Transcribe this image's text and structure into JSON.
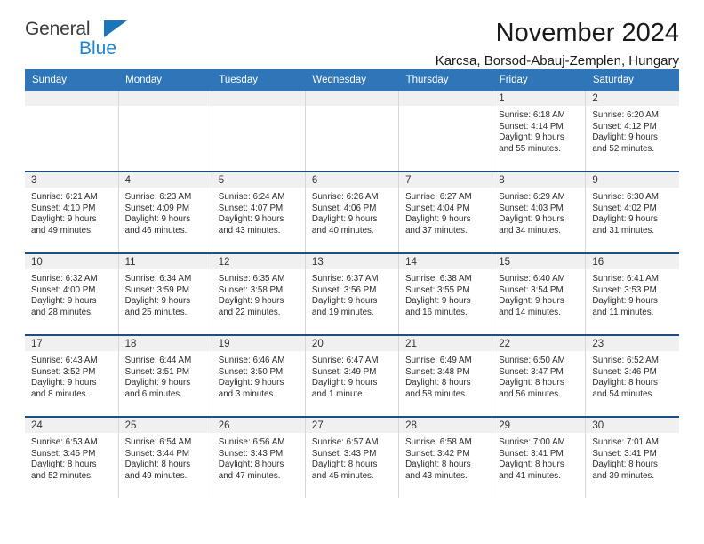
{
  "brand": {
    "name_top": "General",
    "name_bottom": "Blue",
    "triangle_color": "#1b75bb"
  },
  "header": {
    "title": "November 2024",
    "subtitle": "Karcsa, Borsod-Abauj-Zemplen, Hungary"
  },
  "theme": {
    "header_blue": "#2e76b8",
    "row_rule": "#1c4e80",
    "daynum_band": "#f0f0f0"
  },
  "weekday_headers": [
    "Sunday",
    "Monday",
    "Tuesday",
    "Wednesday",
    "Thursday",
    "Friday",
    "Saturday"
  ],
  "weeks": [
    [
      {
        "day": "",
        "empty": true,
        "sunrise": "",
        "sunset": "",
        "daylight_line1": "",
        "daylight_line2": ""
      },
      {
        "day": "",
        "empty": true,
        "sunrise": "",
        "sunset": "",
        "daylight_line1": "",
        "daylight_line2": ""
      },
      {
        "day": "",
        "empty": true,
        "sunrise": "",
        "sunset": "",
        "daylight_line1": "",
        "daylight_line2": ""
      },
      {
        "day": "",
        "empty": true,
        "sunrise": "",
        "sunset": "",
        "daylight_line1": "",
        "daylight_line2": ""
      },
      {
        "day": "",
        "empty": true,
        "sunrise": "",
        "sunset": "",
        "daylight_line1": "",
        "daylight_line2": ""
      },
      {
        "day": "1",
        "empty": false,
        "sunrise": "Sunrise: 6:18 AM",
        "sunset": "Sunset: 4:14 PM",
        "daylight_line1": "Daylight: 9 hours",
        "daylight_line2": "and 55 minutes."
      },
      {
        "day": "2",
        "empty": false,
        "sunrise": "Sunrise: 6:20 AM",
        "sunset": "Sunset: 4:12 PM",
        "daylight_line1": "Daylight: 9 hours",
        "daylight_line2": "and 52 minutes."
      }
    ],
    [
      {
        "day": "3",
        "empty": false,
        "sunrise": "Sunrise: 6:21 AM",
        "sunset": "Sunset: 4:10 PM",
        "daylight_line1": "Daylight: 9 hours",
        "daylight_line2": "and 49 minutes."
      },
      {
        "day": "4",
        "empty": false,
        "sunrise": "Sunrise: 6:23 AM",
        "sunset": "Sunset: 4:09 PM",
        "daylight_line1": "Daylight: 9 hours",
        "daylight_line2": "and 46 minutes."
      },
      {
        "day": "5",
        "empty": false,
        "sunrise": "Sunrise: 6:24 AM",
        "sunset": "Sunset: 4:07 PM",
        "daylight_line1": "Daylight: 9 hours",
        "daylight_line2": "and 43 minutes."
      },
      {
        "day": "6",
        "empty": false,
        "sunrise": "Sunrise: 6:26 AM",
        "sunset": "Sunset: 4:06 PM",
        "daylight_line1": "Daylight: 9 hours",
        "daylight_line2": "and 40 minutes."
      },
      {
        "day": "7",
        "empty": false,
        "sunrise": "Sunrise: 6:27 AM",
        "sunset": "Sunset: 4:04 PM",
        "daylight_line1": "Daylight: 9 hours",
        "daylight_line2": "and 37 minutes."
      },
      {
        "day": "8",
        "empty": false,
        "sunrise": "Sunrise: 6:29 AM",
        "sunset": "Sunset: 4:03 PM",
        "daylight_line1": "Daylight: 9 hours",
        "daylight_line2": "and 34 minutes."
      },
      {
        "day": "9",
        "empty": false,
        "sunrise": "Sunrise: 6:30 AM",
        "sunset": "Sunset: 4:02 PM",
        "daylight_line1": "Daylight: 9 hours",
        "daylight_line2": "and 31 minutes."
      }
    ],
    [
      {
        "day": "10",
        "empty": false,
        "sunrise": "Sunrise: 6:32 AM",
        "sunset": "Sunset: 4:00 PM",
        "daylight_line1": "Daylight: 9 hours",
        "daylight_line2": "and 28 minutes."
      },
      {
        "day": "11",
        "empty": false,
        "sunrise": "Sunrise: 6:34 AM",
        "sunset": "Sunset: 3:59 PM",
        "daylight_line1": "Daylight: 9 hours",
        "daylight_line2": "and 25 minutes."
      },
      {
        "day": "12",
        "empty": false,
        "sunrise": "Sunrise: 6:35 AM",
        "sunset": "Sunset: 3:58 PM",
        "daylight_line1": "Daylight: 9 hours",
        "daylight_line2": "and 22 minutes."
      },
      {
        "day": "13",
        "empty": false,
        "sunrise": "Sunrise: 6:37 AM",
        "sunset": "Sunset: 3:56 PM",
        "daylight_line1": "Daylight: 9 hours",
        "daylight_line2": "and 19 minutes."
      },
      {
        "day": "14",
        "empty": false,
        "sunrise": "Sunrise: 6:38 AM",
        "sunset": "Sunset: 3:55 PM",
        "daylight_line1": "Daylight: 9 hours",
        "daylight_line2": "and 16 minutes."
      },
      {
        "day": "15",
        "empty": false,
        "sunrise": "Sunrise: 6:40 AM",
        "sunset": "Sunset: 3:54 PM",
        "daylight_line1": "Daylight: 9 hours",
        "daylight_line2": "and 14 minutes."
      },
      {
        "day": "16",
        "empty": false,
        "sunrise": "Sunrise: 6:41 AM",
        "sunset": "Sunset: 3:53 PM",
        "daylight_line1": "Daylight: 9 hours",
        "daylight_line2": "and 11 minutes."
      }
    ],
    [
      {
        "day": "17",
        "empty": false,
        "sunrise": "Sunrise: 6:43 AM",
        "sunset": "Sunset: 3:52 PM",
        "daylight_line1": "Daylight: 9 hours",
        "daylight_line2": "and 8 minutes."
      },
      {
        "day": "18",
        "empty": false,
        "sunrise": "Sunrise: 6:44 AM",
        "sunset": "Sunset: 3:51 PM",
        "daylight_line1": "Daylight: 9 hours",
        "daylight_line2": "and 6 minutes."
      },
      {
        "day": "19",
        "empty": false,
        "sunrise": "Sunrise: 6:46 AM",
        "sunset": "Sunset: 3:50 PM",
        "daylight_line1": "Daylight: 9 hours",
        "daylight_line2": "and 3 minutes."
      },
      {
        "day": "20",
        "empty": false,
        "sunrise": "Sunrise: 6:47 AM",
        "sunset": "Sunset: 3:49 PM",
        "daylight_line1": "Daylight: 9 hours",
        "daylight_line2": "and 1 minute."
      },
      {
        "day": "21",
        "empty": false,
        "sunrise": "Sunrise: 6:49 AM",
        "sunset": "Sunset: 3:48 PM",
        "daylight_line1": "Daylight: 8 hours",
        "daylight_line2": "and 58 minutes."
      },
      {
        "day": "22",
        "empty": false,
        "sunrise": "Sunrise: 6:50 AM",
        "sunset": "Sunset: 3:47 PM",
        "daylight_line1": "Daylight: 8 hours",
        "daylight_line2": "and 56 minutes."
      },
      {
        "day": "23",
        "empty": false,
        "sunrise": "Sunrise: 6:52 AM",
        "sunset": "Sunset: 3:46 PM",
        "daylight_line1": "Daylight: 8 hours",
        "daylight_line2": "and 54 minutes."
      }
    ],
    [
      {
        "day": "24",
        "empty": false,
        "sunrise": "Sunrise: 6:53 AM",
        "sunset": "Sunset: 3:45 PM",
        "daylight_line1": "Daylight: 8 hours",
        "daylight_line2": "and 52 minutes."
      },
      {
        "day": "25",
        "empty": false,
        "sunrise": "Sunrise: 6:54 AM",
        "sunset": "Sunset: 3:44 PM",
        "daylight_line1": "Daylight: 8 hours",
        "daylight_line2": "and 49 minutes."
      },
      {
        "day": "26",
        "empty": false,
        "sunrise": "Sunrise: 6:56 AM",
        "sunset": "Sunset: 3:43 PM",
        "daylight_line1": "Daylight: 8 hours",
        "daylight_line2": "and 47 minutes."
      },
      {
        "day": "27",
        "empty": false,
        "sunrise": "Sunrise: 6:57 AM",
        "sunset": "Sunset: 3:43 PM",
        "daylight_line1": "Daylight: 8 hours",
        "daylight_line2": "and 45 minutes."
      },
      {
        "day": "28",
        "empty": false,
        "sunrise": "Sunrise: 6:58 AM",
        "sunset": "Sunset: 3:42 PM",
        "daylight_line1": "Daylight: 8 hours",
        "daylight_line2": "and 43 minutes."
      },
      {
        "day": "29",
        "empty": false,
        "sunrise": "Sunrise: 7:00 AM",
        "sunset": "Sunset: 3:41 PM",
        "daylight_line1": "Daylight: 8 hours",
        "daylight_line2": "and 41 minutes."
      },
      {
        "day": "30",
        "empty": false,
        "sunrise": "Sunrise: 7:01 AM",
        "sunset": "Sunset: 3:41 PM",
        "daylight_line1": "Daylight: 8 hours",
        "daylight_line2": "and 39 minutes."
      }
    ]
  ]
}
